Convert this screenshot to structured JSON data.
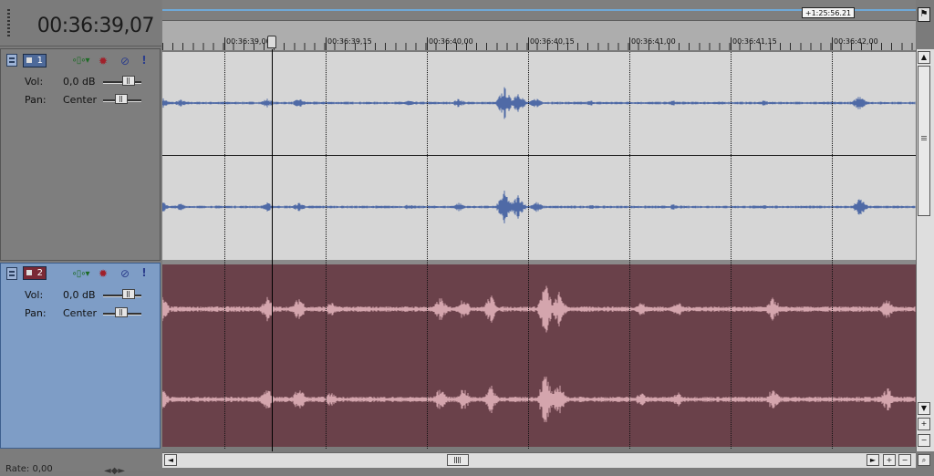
{
  "time_display": "00:36:39,07",
  "end_marker": "+1:25:56.21",
  "ruler_labels": [
    "00:36:39,00",
    "00:36:39,15",
    "00:36:40,00",
    "00:36:40,15",
    "00:36:41,00",
    "00:36:41,15",
    "00:36:42,00"
  ],
  "tracks": [
    {
      "number": "1",
      "vol_label": "Vol:",
      "vol_value": "0,0 dB",
      "pan_label": "Pan:",
      "pan_value": "Center",
      "waveform_color": "#4f6aa6",
      "lane_color": "#d6d6d6"
    },
    {
      "number": "2",
      "vol_label": "Vol:",
      "vol_value": "0,0 dB",
      "pan_label": "Pan:",
      "pan_value": "Center",
      "waveform_color": "#d4a5ad",
      "lane_color": "#6a414a"
    }
  ],
  "footer": {
    "rate": "Rate: 0,00"
  },
  "colors": {
    "selected_track_header": "#7e9dc6",
    "marker_line": "#6fa9d8"
  },
  "icons": {
    "flag": "flag-icon",
    "fx": "gear-icon",
    "mute": "mute-icon",
    "solo": "exclamation-icon",
    "automation": "envelope-icon"
  }
}
